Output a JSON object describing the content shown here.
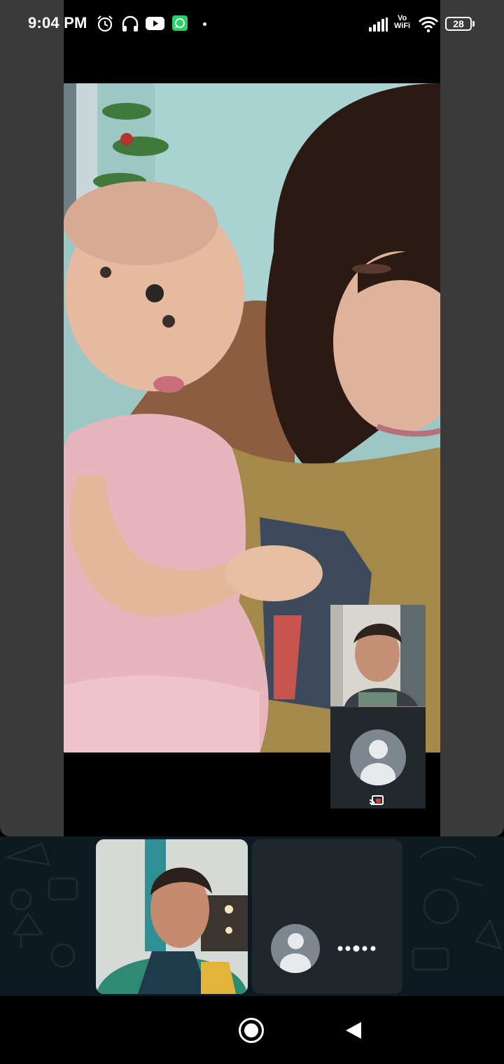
{
  "status_bar": {
    "time": "9:04 PM",
    "vowifi_top": "Vo",
    "vowifi_bottom": "WiFi",
    "battery_level": "28",
    "notification_icons": [
      "alarm-icon",
      "headset-icon",
      "youtube-icon",
      "whatsapp-icon"
    ],
    "system_icons": [
      "signal-icon",
      "wifi-icon",
      "battery-icon"
    ]
  },
  "call": {
    "main_feed": "remote-participant-video",
    "pip_feed": "self-camera-preview",
    "pip_placeholder": "avatar-icon",
    "cast_indicator": "cast-icon"
  },
  "tray": {
    "participants": [
      {
        "kind": "video",
        "icon": "participant-video"
      },
      {
        "kind": "ringing",
        "icon": "avatar-icon",
        "indicator": "ringing-dots-icon"
      }
    ]
  },
  "nav_bar": {
    "buttons": [
      "home-button",
      "back-button"
    ]
  },
  "colors": {
    "window_bg": "#3a3a3a",
    "tray_bg": "#0e1a21",
    "tile_dark": "#1f272c",
    "avatar_circle": "#7e8790",
    "whatsapp_green": "#25d366"
  }
}
